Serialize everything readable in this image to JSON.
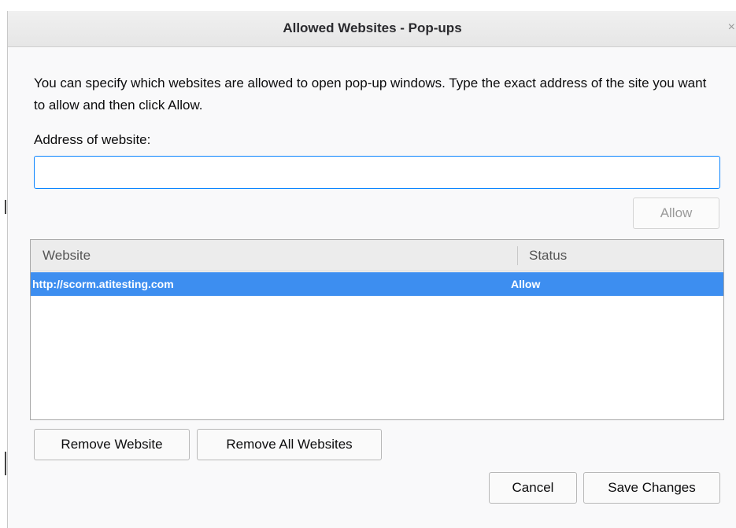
{
  "dialog": {
    "title": "Allowed Websites - Pop-ups",
    "close_glyph": "×",
    "description": "You can specify which websites are allowed to open pop-up windows. Type the exact address of the site you want to allow and then click Allow.",
    "address_label": "Address of website:",
    "address_value": "",
    "allow_label": "Allow"
  },
  "list": {
    "columns": [
      "Website",
      "Status"
    ],
    "rows": [
      {
        "website": "http://scorm.atitesting.com",
        "status": "Allow"
      }
    ]
  },
  "actions": {
    "remove_website": "Remove Website",
    "remove_all": "Remove All Websites",
    "cancel": "Cancel",
    "save": "Save Changes"
  },
  "colors": {
    "selection": "#3d8ef0",
    "focus_border": "#0a84ff"
  }
}
